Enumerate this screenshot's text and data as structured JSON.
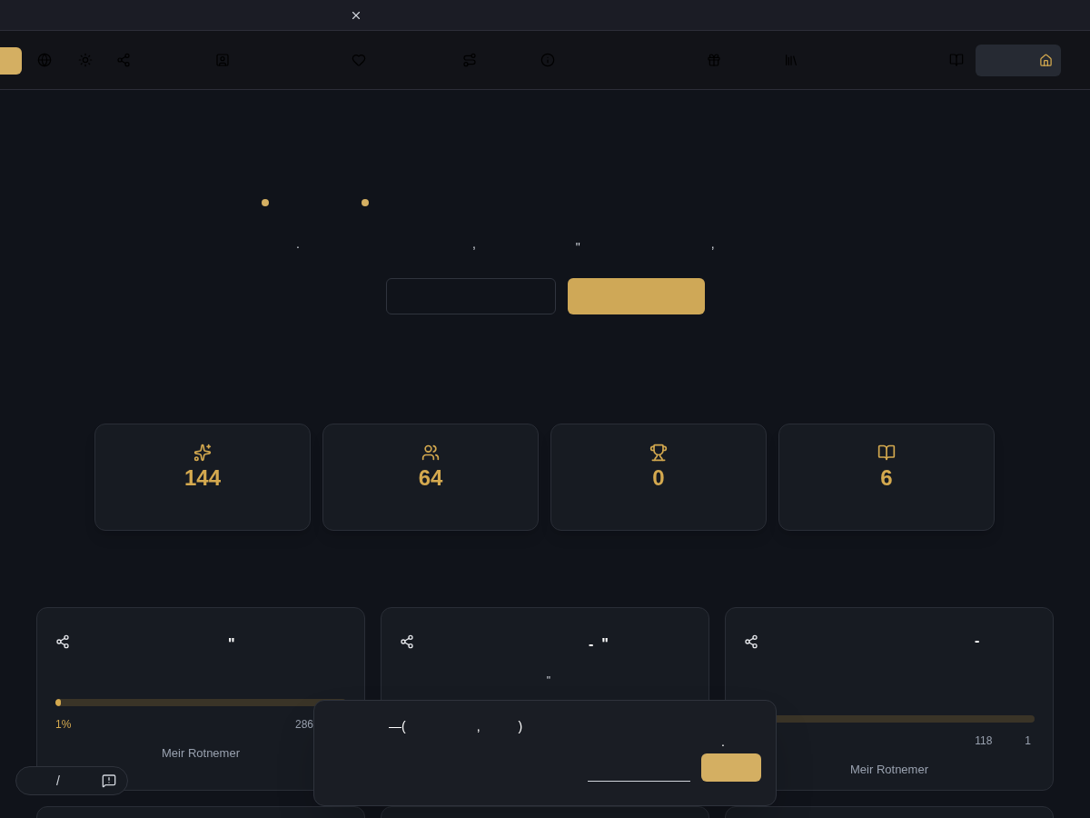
{
  "hero": {
    "marks": [
      ".",
      ",",
      "\"",
      ","
    ]
  },
  "stats": [
    {
      "kind": "sparkles",
      "value": "144"
    },
    {
      "kind": "users",
      "value": "64"
    },
    {
      "kind": "trophy",
      "value": "0"
    },
    {
      "kind": "book",
      "value": "6"
    }
  ],
  "projects": [
    {
      "heading": "\"",
      "progress": {
        "level": 0.01,
        "percent": "1%",
        "counts": [
          "286"
        ]
      },
      "author": "Meir Rotnemer"
    },
    {
      "heading": "-  \"",
      "lines": [
        "\""
      ]
    },
    {
      "heading": "-",
      "progress": {
        "counts": [
          "118",
          "1"
        ]
      },
      "author": "Meir Rotnemer"
    }
  ],
  "popup": {
    "parts": [
      "—(",
      ",",
      ")"
    ],
    "note": "."
  },
  "pill": {
    "text": "/"
  }
}
